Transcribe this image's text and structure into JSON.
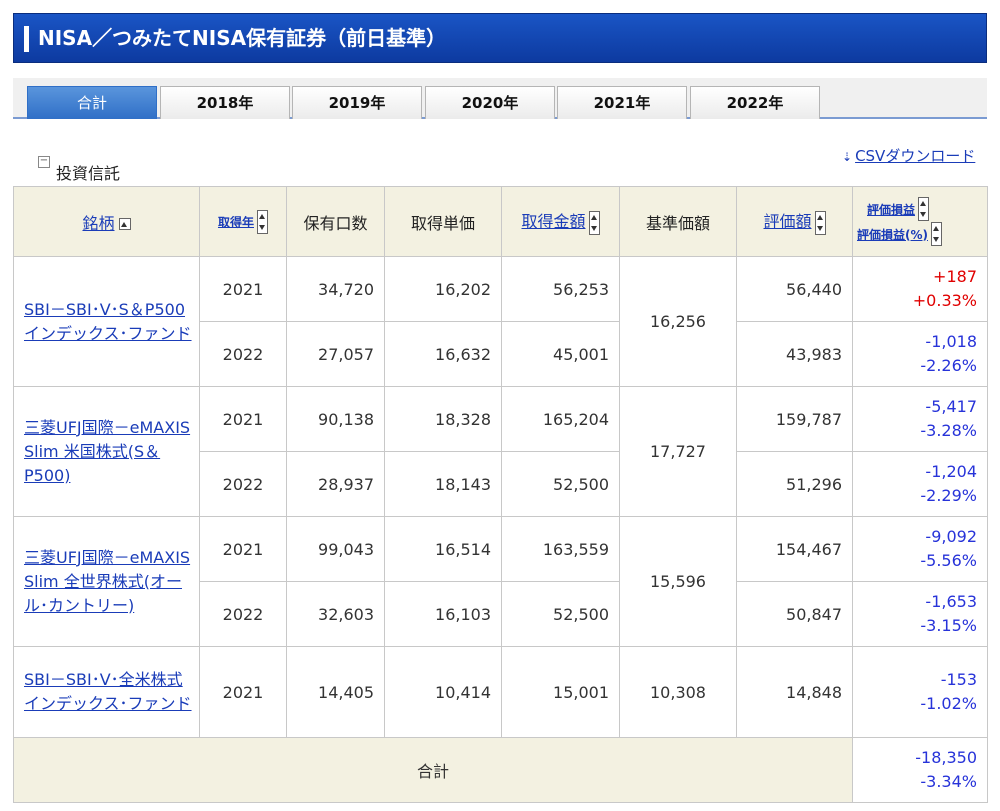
{
  "title": "NISA／つみたてNISA保有証券（前日基準）",
  "tabs": [
    "合計",
    "2018年",
    "2019年",
    "2020年",
    "2021年",
    "2022年"
  ],
  "section": {
    "label": "投資信託",
    "csv": "CSVダウンロード"
  },
  "headers": {
    "name": "銘柄",
    "year": "取得年",
    "units": "保有口数",
    "unit_cost": "取得単価",
    "cost": "取得金額",
    "nav": "基準価額",
    "value": "評価額",
    "pl": "評価損益",
    "pl_pct": "評価損益(%)"
  },
  "funds": [
    {
      "name": "SBI－SBI･V･S＆P500インデックス･ファンド",
      "nav": "16,256",
      "lots": [
        {
          "year": "2021",
          "units": "34,720",
          "unit_cost": "16,202",
          "cost": "56,253",
          "value": "56,440",
          "pl": "+187",
          "pl_pct": "+0.33%"
        },
        {
          "year": "2022",
          "units": "27,057",
          "unit_cost": "16,632",
          "cost": "45,001",
          "value": "43,983",
          "pl": "-1,018",
          "pl_pct": "-2.26%"
        }
      ]
    },
    {
      "name": "三菱UFJ国際－eMAXIS Slim 米国株式(S＆P500)",
      "nav": "17,727",
      "lots": [
        {
          "year": "2021",
          "units": "90,138",
          "unit_cost": "18,328",
          "cost": "165,204",
          "value": "159,787",
          "pl": "-5,417",
          "pl_pct": "-3.28%"
        },
        {
          "year": "2022",
          "units": "28,937",
          "unit_cost": "18,143",
          "cost": "52,500",
          "value": "51,296",
          "pl": "-1,204",
          "pl_pct": "-2.29%"
        }
      ]
    },
    {
      "name": "三菱UFJ国際－eMAXIS Slim 全世界株式(オール･カントリー)",
      "nav": "15,596",
      "lots": [
        {
          "year": "2021",
          "units": "99,043",
          "unit_cost": "16,514",
          "cost": "163,559",
          "value": "154,467",
          "pl": "-9,092",
          "pl_pct": "-5.56%"
        },
        {
          "year": "2022",
          "units": "32,603",
          "unit_cost": "16,103",
          "cost": "52,500",
          "value": "50,847",
          "pl": "-1,653",
          "pl_pct": "-3.15%"
        }
      ]
    },
    {
      "name": "SBI－SBI･V･全米株式インデックス･ファンド",
      "nav": "10,308",
      "lots": [
        {
          "year": "2021",
          "units": "14,405",
          "unit_cost": "10,414",
          "cost": "15,001",
          "value": "14,848",
          "pl": "-153",
          "pl_pct": "-1.02%"
        }
      ]
    }
  ],
  "total": {
    "label": "合計",
    "pl": "-18,350",
    "pl_pct": "-3.34%"
  },
  "colors": {
    "title_bg": "#1a55c5",
    "positive": "#e00000",
    "negative": "#2733d9",
    "header_bg": "#f3f1e1",
    "link": "#1a3cb8"
  }
}
